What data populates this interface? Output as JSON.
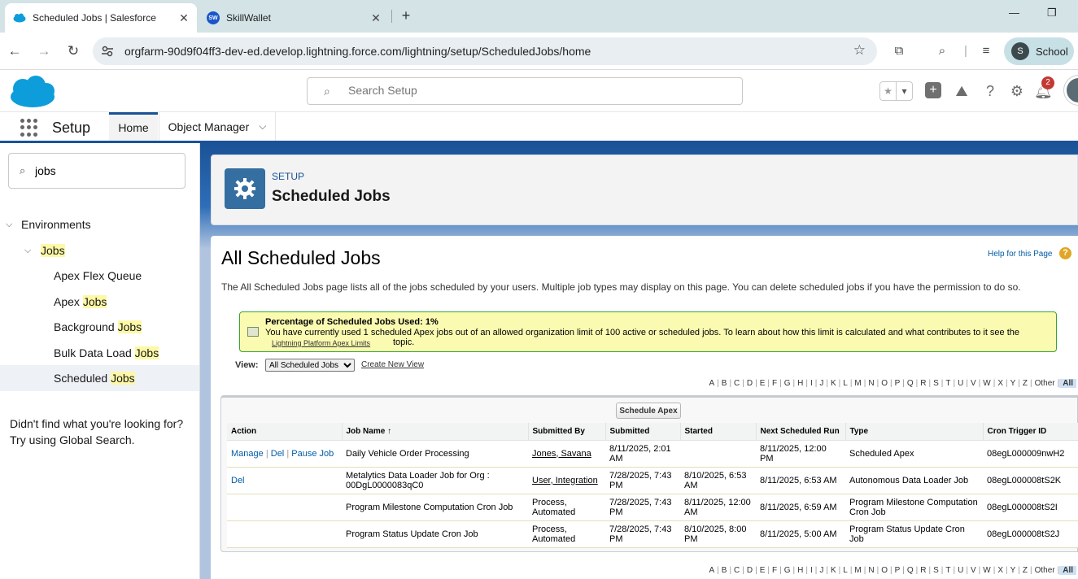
{
  "browser": {
    "tabs": [
      {
        "title": "Scheduled Jobs | Salesforce",
        "active": true
      },
      {
        "title": "SkillWallet",
        "active": false,
        "favicon_text": "SW"
      }
    ],
    "url": "orgfarm-90d9f04ff3-dev-ed.develop.lightning.force.com/lightning/setup/ScheduledJobs/home",
    "profile": {
      "initial": "S",
      "label": "School"
    }
  },
  "sf_header": {
    "search_placeholder": "Search Setup",
    "notification_count": "2"
  },
  "context_bar": {
    "app_name": "Setup",
    "tabs": [
      {
        "label": "Home"
      },
      {
        "label": "Object Manager"
      }
    ]
  },
  "sidebar": {
    "quick_find_value": "jobs",
    "tree": [
      {
        "label": "Environments"
      },
      {
        "label": "Jobs"
      },
      {
        "prefix": "Apex Flex Queue",
        "match": ""
      },
      {
        "prefix": "Apex ",
        "match": "Jobs"
      },
      {
        "prefix": "Background ",
        "match": "Jobs"
      },
      {
        "prefix": "Bulk Data Load ",
        "match": "Jobs"
      },
      {
        "prefix": "Scheduled ",
        "match": "Jobs"
      }
    ],
    "not_found_line1": "Didn't find what you're looking for?",
    "not_found_line2": "Try using Global Search."
  },
  "page_header": {
    "eyebrow": "SETUP",
    "title": "Scheduled Jobs"
  },
  "content": {
    "title": "All Scheduled Jobs",
    "help_link": "Help for this Page",
    "description": "The All Scheduled Jobs page lists all of the jobs scheduled by your users. Multiple job types may display on this page. You can delete scheduled jobs if you have the permission to do so.",
    "info": {
      "title": "Percentage of Scheduled Jobs Used: 1%",
      "body": "You have currently used 1 scheduled Apex jobs out of an allowed organization limit of 100 active or scheduled jobs. To learn about how this limit is calculated and what contributes to it see the",
      "link": "Lightning Platform Apex Limits",
      "tail": "topic."
    },
    "view_label": "View:",
    "view_selected": "All Scheduled Jobs",
    "create_view": "Create New View",
    "alphabet": [
      "A",
      "B",
      "C",
      "D",
      "E",
      "F",
      "G",
      "H",
      "I",
      "J",
      "K",
      "L",
      "M",
      "N",
      "O",
      "P",
      "Q",
      "R",
      "S",
      "T",
      "U",
      "V",
      "W",
      "X",
      "Y",
      "Z",
      "Other",
      "All"
    ],
    "schedule_button": "Schedule Apex",
    "table": {
      "headers": [
        "Action",
        "Job Name ↑",
        "Submitted By",
        "Submitted",
        "Started",
        "Next Scheduled Run",
        "Type",
        "Cron Trigger ID"
      ],
      "rows": [
        {
          "actions": [
            "Manage",
            "Del",
            "Pause Job"
          ],
          "job_name": "Daily Vehicle Order Processing",
          "submitted_by": "Jones, Savana",
          "submitted": "8/11/2025, 2:01 AM",
          "started": "",
          "next_run": "8/11/2025, 12:00 PM",
          "type": "Scheduled Apex",
          "cron_id": "08egL000009nwH2"
        },
        {
          "actions": [
            "Del"
          ],
          "job_name": "Metalytics Data Loader Job for Org : 00DgL0000083qC0",
          "submitted_by": "User, Integration",
          "submitted": "7/28/2025, 7:43 PM",
          "started": "8/10/2025, 6:53 AM",
          "next_run": "8/11/2025, 6:53 AM",
          "type": "Autonomous Data Loader Job",
          "cron_id": "08egL000008tS2K"
        },
        {
          "actions": [],
          "job_name": "Program Milestone Computation Cron Job",
          "submitted_by": "Process, Automated",
          "submitted": "7/28/2025, 7:43 PM",
          "started": "8/11/2025, 12:00 AM",
          "next_run": "8/11/2025, 6:59 AM",
          "type": "Program Milestone Computation Cron Job",
          "cron_id": "08egL000008tS2I"
        },
        {
          "actions": [],
          "job_name": "Program Status Update Cron Job",
          "submitted_by": "Process, Automated",
          "submitted": "7/28/2025, 7:43 PM",
          "started": "8/10/2025, 8:00 PM",
          "next_run": "8/11/2025, 5:00 AM",
          "type": "Program Status Update Cron Job",
          "cron_id": "08egL000008tS2J"
        }
      ]
    }
  }
}
